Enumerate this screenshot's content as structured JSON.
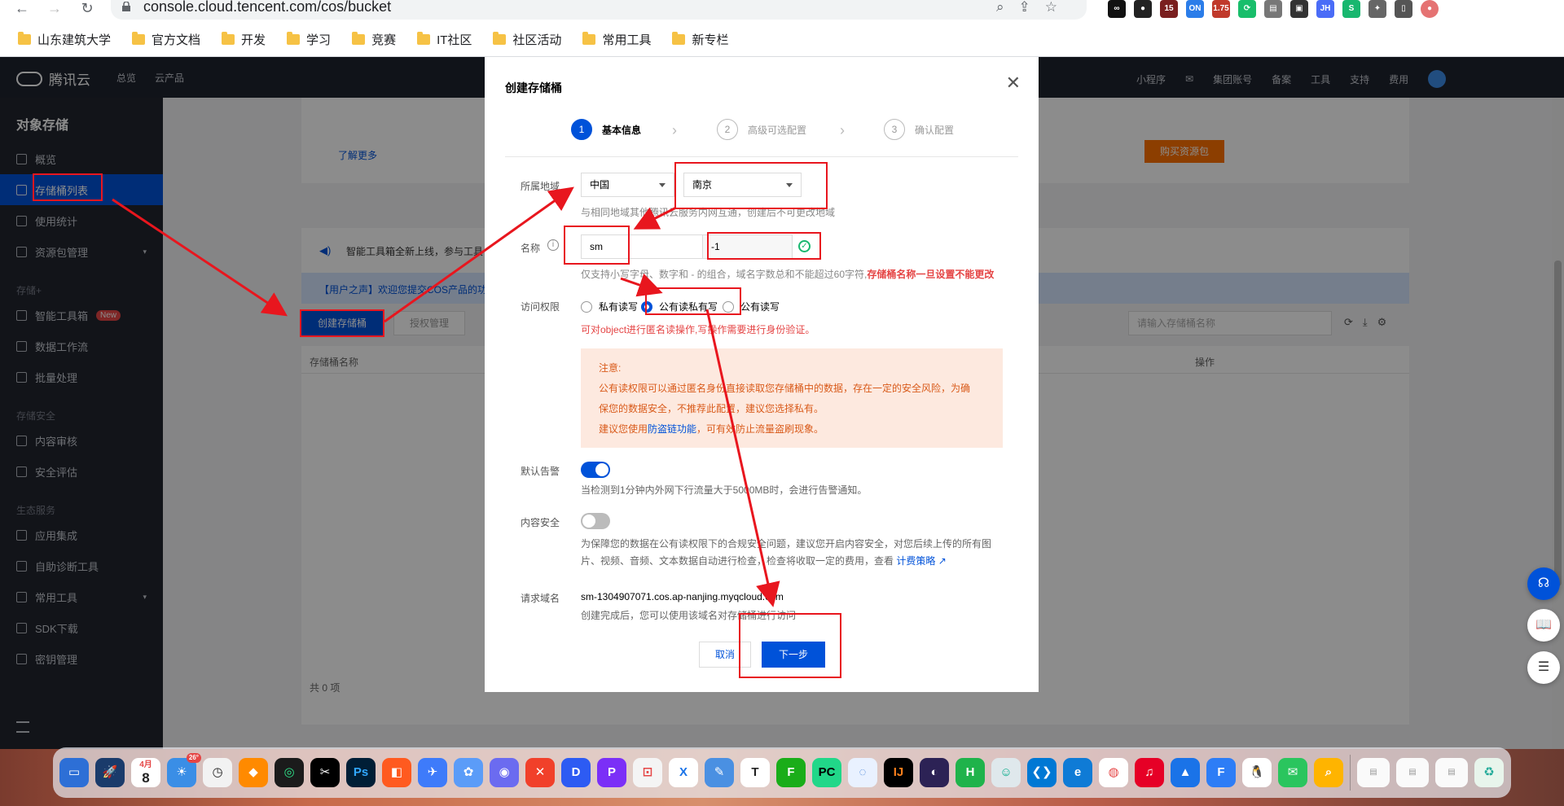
{
  "browser": {
    "url": "console.cloud.tencent.com/cos/bucket",
    "bookmarks": [
      "山东建筑大学",
      "官方文档",
      "开发",
      "学习",
      "竞赛",
      "IT社区",
      "社区活动",
      "常用工具",
      "新专栏"
    ],
    "ext_badges": [
      "15",
      "ON",
      "1.75",
      "JH"
    ]
  },
  "topnav": {
    "brand": "腾讯云",
    "overview": "总览",
    "products": "云产品",
    "right_items": [
      "小程序",
      "集团账号",
      "备案",
      "工具",
      "支持",
      "费用"
    ]
  },
  "sidebar": {
    "title": "对象存储",
    "items": [
      {
        "label": "概览"
      },
      {
        "label": "存储桶列表"
      },
      {
        "label": "使用统计"
      },
      {
        "label": "资源包管理"
      }
    ],
    "group_storage_plus": "存储+",
    "storage_plus_items": [
      {
        "label": "智能工具箱",
        "badge": "New"
      },
      {
        "label": "数据工作流"
      },
      {
        "label": "批量处理"
      }
    ],
    "group_security": "存储安全",
    "security_items": [
      {
        "label": "内容审核"
      },
      {
        "label": "安全评估"
      }
    ],
    "group_eco": "生态服务",
    "eco_items": [
      {
        "label": "应用集成"
      },
      {
        "label": "自助诊断工具"
      },
      {
        "label": "常用工具"
      },
      {
        "label": "SDK下载"
      },
      {
        "label": "密钥管理"
      }
    ]
  },
  "background": {
    "learn_more": "了解更多",
    "buy_package": "购买资源包",
    "banner_notice": "智能工具箱全新上线，参与工具",
    "voice_banner": "【用户之声】欢迎您提交COS产品的功",
    "create_bucket": "创建存储桶",
    "auth_manage": "授权管理",
    "search_placeholder": "请输入存储桶名称",
    "col_name": "存储桶名称",
    "col_ops": "操作",
    "total": "共 0 项"
  },
  "modal": {
    "title": "创建存储桶",
    "steps": [
      {
        "num": "1",
        "label": "基本信息"
      },
      {
        "num": "2",
        "label": "高级可选配置"
      },
      {
        "num": "3",
        "label": "确认配置"
      }
    ],
    "region_label": "所属地域",
    "region_country": "中国",
    "region_city": "南京",
    "region_help": "与相同地域其他腾讯云服务内网互通，创建后不可更改地域",
    "name_label": "名称",
    "name_value": "sm",
    "name_suffix": "-1",
    "name_help": "仅支持小写字母、数字和 - 的组合，域名字数总和不能超过60字符,",
    "name_warning": "存储桶名称一旦设置不能更改",
    "access_label": "访问权限",
    "access_options": [
      "私有读写",
      "公有读私有写",
      "公有读写"
    ],
    "access_selected": 1,
    "access_warning": "可对object进行匿名读操作,写操作需要进行身份验证。",
    "notice_title": "注意:",
    "notice_line1": "公有读权限可以通过匿名身份直接读取您存储桶中的数据，存在一定的安全风险，为确",
    "notice_line2": "保您的数据安全，不推荐此配置，建议您选择私有。",
    "notice_line3_prefix": "建议您使用",
    "notice_link": "防盗链功能",
    "notice_line3_suffix": "，可有效防止流量盗刷现象。",
    "alarm_label": "默认告警",
    "alarm_on": true,
    "alarm_help": "当检测到1分钟内外网下行流量大于5000MB时，会进行告警通知。",
    "security_label": "内容安全",
    "security_on": false,
    "security_help1": "为保障您的数据在公有读权限下的合规安全问题，建议您开启内容安全，对您后续上传的所有图",
    "security_help2": "片、视频、音频、文本数据自动进行检查，检查将收取一定的费用，查看",
    "security_link": "计费策略",
    "domain_label": "请求域名",
    "domain_value": "sm-1304907071.cos.ap-nanjing.myqcloud.com",
    "domain_help": "创建完成后，您可以使用该域名对存储桶进行访问",
    "cancel": "取消",
    "next": "下一步"
  },
  "dock": {
    "calendar_month": "4月",
    "calendar_day": "8",
    "weather_badge": "26°"
  },
  "colors": {
    "primary": "#0052d9",
    "annotation": "#e8161e",
    "warning": "#e54545",
    "orange": "#ff7200"
  }
}
